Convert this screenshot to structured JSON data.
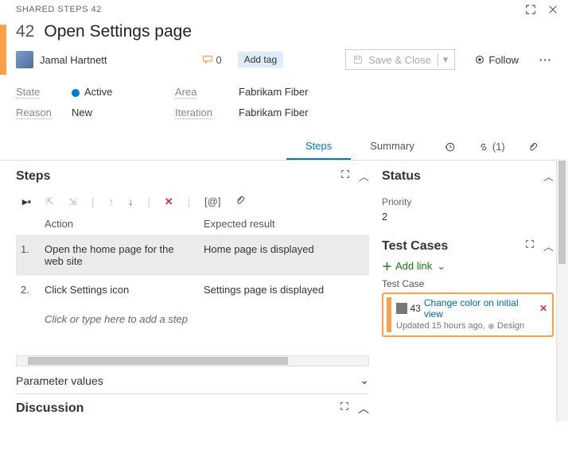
{
  "header": {
    "breadcrumb": "SHARED STEPS 42"
  },
  "workitem": {
    "id": "42",
    "title": "Open Settings page",
    "assignee": "Jamal Hartnett",
    "comment_count": "0",
    "add_tag": "Add tag",
    "save_label": "Save & Close",
    "follow_label": "Follow"
  },
  "fields": {
    "state_lbl": "State",
    "state_val": "Active",
    "reason_lbl": "Reason",
    "reason_val": "New",
    "area_lbl": "Area",
    "area_val": "Fabrikam Fiber",
    "iter_lbl": "Iteration",
    "iter_val": "Fabrikam Fiber"
  },
  "tabs": {
    "steps": "Steps",
    "summary": "Summary",
    "links_count": "(1)"
  },
  "steps": {
    "heading": "Steps",
    "col_action": "Action",
    "col_expected": "Expected result",
    "rows": [
      {
        "num": "1.",
        "action": "Open the home page for the web site",
        "expected": "Home page is displayed"
      },
      {
        "num": "2.",
        "action": "Click Settings icon",
        "expected": "Settings page is displayed"
      }
    ],
    "placeholder": "Click or type here to add a step",
    "param_values": "Parameter values",
    "discussion": "Discussion"
  },
  "side": {
    "status_heading": "Status",
    "priority_lbl": "Priority",
    "priority_val": "2",
    "tc_heading": "Test Cases",
    "add_link": "Add link",
    "tc_label": "Test Case",
    "linked": {
      "id": "43",
      "title": "Change color on initial view",
      "updated": "Updated 15 hours ago,",
      "state": "Design"
    }
  }
}
